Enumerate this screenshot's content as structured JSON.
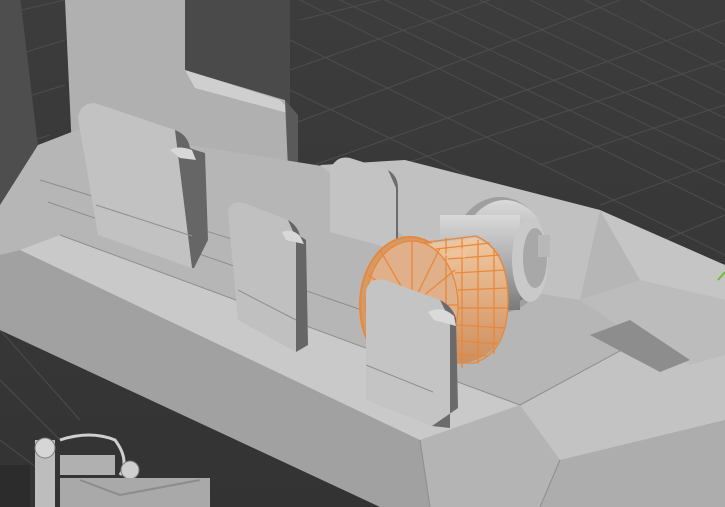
{
  "app": {
    "name": "3D viewport",
    "view": "perspective"
  },
  "scene": {
    "objects": [
      {
        "id": "base-block",
        "kind": "mesh",
        "selected": false
      },
      {
        "id": "back-panel",
        "kind": "mesh",
        "selected": false
      },
      {
        "id": "left-plate",
        "kind": "mesh",
        "selected": false
      },
      {
        "id": "middle-plate",
        "kind": "mesh",
        "selected": false
      },
      {
        "id": "back-small-plate",
        "kind": "mesh",
        "selected": false
      },
      {
        "id": "front-plate",
        "kind": "mesh",
        "selected": false
      },
      {
        "id": "gray-cylinder",
        "kind": "mesh",
        "selected": false
      },
      {
        "id": "orange-cylinder",
        "kind": "mesh",
        "selected": true
      },
      {
        "id": "front-mechanism",
        "kind": "mesh",
        "selected": false
      }
    ]
  },
  "colors": {
    "viewport_bg": "#3a3a3a",
    "grid_line": "#4a4a4a",
    "mesh_light": "#c8c8c8",
    "mesh_mid": "#a9a9a9",
    "mesh_dark": "#6b6b6b",
    "selection": "#e8883a",
    "selection_wire": "#d86f20",
    "axis_green": "#6fbf2f"
  }
}
